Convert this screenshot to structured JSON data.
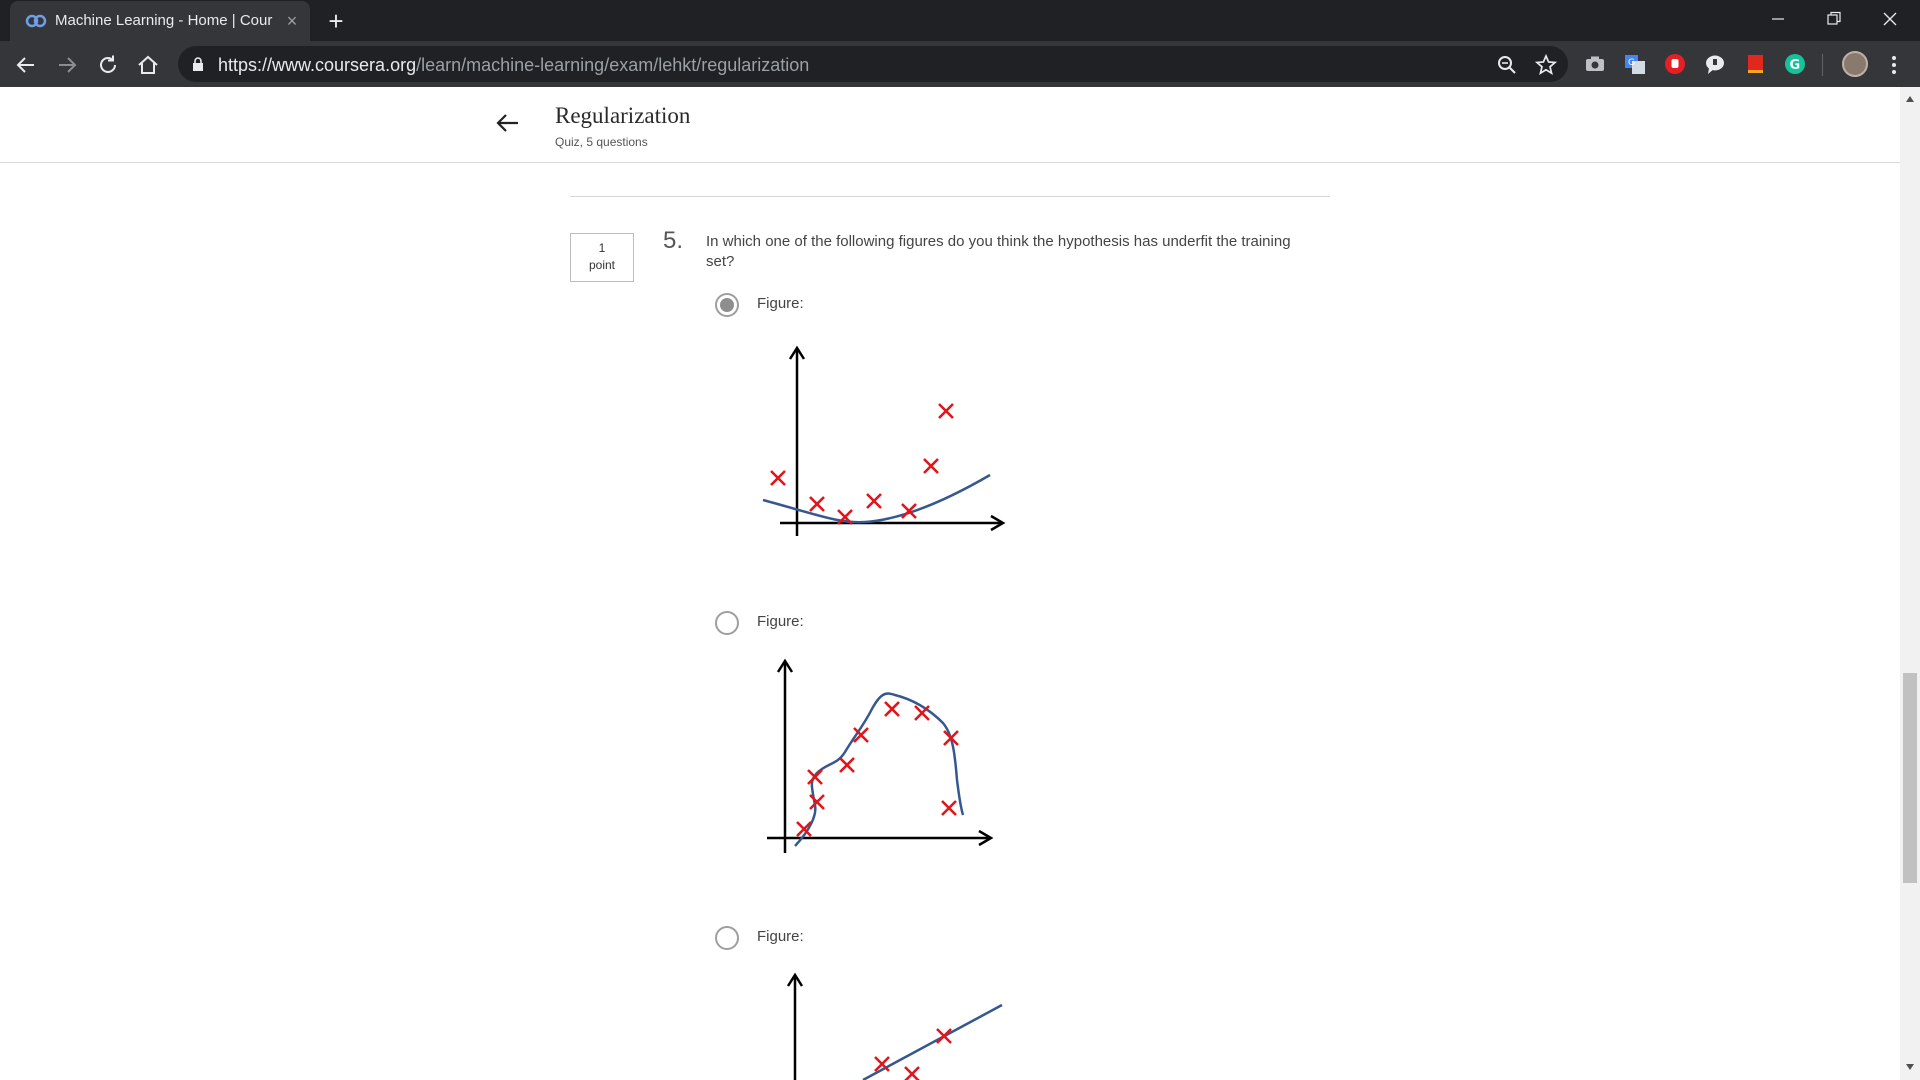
{
  "browser": {
    "tab_title": "Machine Learning - Home | Cour",
    "tab_close": "×",
    "new_tab": "+",
    "url_host": "https://www.coursera.org",
    "url_path": "/learn/machine-learning/exam/lehkt/regularization",
    "icons": [
      "back-icon",
      "forward-icon",
      "reload-icon",
      "home-icon",
      "lock-icon",
      "zoom-icon",
      "bookmark-star-icon",
      "camera-extension-icon",
      "translate-extension-icon",
      "adblock-extension-icon",
      "chat-extension-icon",
      "bookmark-extension-icon",
      "grammarly-extension-icon",
      "profile-avatar",
      "menu-icon"
    ]
  },
  "quiz": {
    "title": "Regularization",
    "subtitle": "Quiz, 5 questions"
  },
  "question": {
    "points_value": "1",
    "points_unit": "point",
    "number": "5.",
    "text": "In which one of the following figures do you think the hypothesis has underfit the training set?",
    "options": [
      {
        "label": "Figure:",
        "selected": true
      },
      {
        "label": "Figure:",
        "selected": false
      },
      {
        "label": "Figure:",
        "selected": false
      }
    ]
  },
  "colors": {
    "marker": "#e0161c",
    "curve": "#35588f",
    "axis": "#000000"
  }
}
